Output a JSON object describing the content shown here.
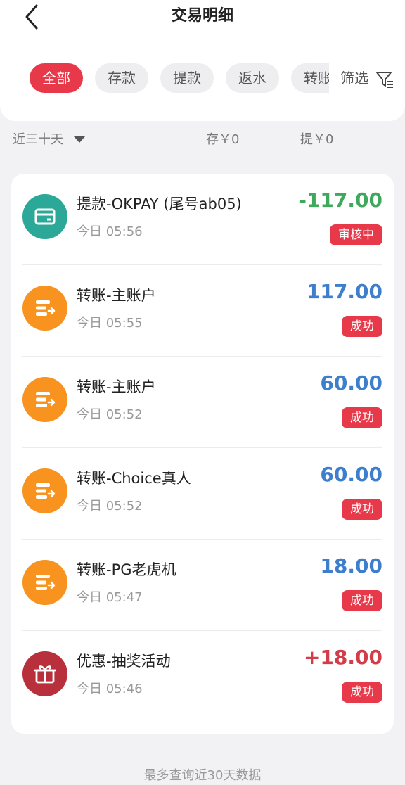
{
  "header": {
    "title": "交易明细",
    "back_icon": "chevron-left-icon"
  },
  "tabs": [
    {
      "label": "全部",
      "active": true
    },
    {
      "label": "存款",
      "active": false
    },
    {
      "label": "提款",
      "active": false
    },
    {
      "label": "返水",
      "active": false
    },
    {
      "label": "转账",
      "active": false
    }
  ],
  "filter": {
    "label": "筛选",
    "icon": "filter-icon"
  },
  "summary": {
    "range": "近三十天",
    "deposit": "存￥0",
    "withdraw": "提￥0"
  },
  "colors": {
    "accent": "#e8394a",
    "amount_negative": "#3ea95a",
    "amount_blue": "#3d7fcc",
    "amount_positive": "#d23d49",
    "avatar_teal": "#2ba897",
    "avatar_orange": "#f7931e",
    "avatar_red": "#b8303c"
  },
  "transactions": [
    {
      "title": "提款-OKPAY (尾号ab05)",
      "time": "今日 05:56",
      "amount": "-117.00",
      "status": "审核中",
      "icon": "card-icon",
      "avatar_color": "#2ba897",
      "amount_color": "#3ea95a"
    },
    {
      "title": "转账-主账户",
      "time": "今日 05:55",
      "amount": "117.00",
      "status": "成功",
      "icon": "transfer-icon",
      "avatar_color": "#f7931e",
      "amount_color": "#3d7fcc"
    },
    {
      "title": "转账-主账户",
      "time": "今日 05:52",
      "amount": "60.00",
      "status": "成功",
      "icon": "transfer-icon",
      "avatar_color": "#f7931e",
      "amount_color": "#3d7fcc"
    },
    {
      "title": "转账-Choice真人",
      "time": "今日 05:52",
      "amount": "60.00",
      "status": "成功",
      "icon": "transfer-icon",
      "avatar_color": "#f7931e",
      "amount_color": "#3d7fcc"
    },
    {
      "title": "转账-PG老虎机",
      "time": "今日 05:47",
      "amount": "18.00",
      "status": "成功",
      "icon": "transfer-icon",
      "avatar_color": "#f7931e",
      "amount_color": "#3d7fcc"
    },
    {
      "title": "优惠-抽奖活动",
      "time": "今日 05:46",
      "amount": "+18.00",
      "status": "成功",
      "icon": "gift-icon",
      "avatar_color": "#b8303c",
      "amount_color": "#d23d49"
    }
  ],
  "footer": {
    "note": "最多查询近30天数据"
  }
}
